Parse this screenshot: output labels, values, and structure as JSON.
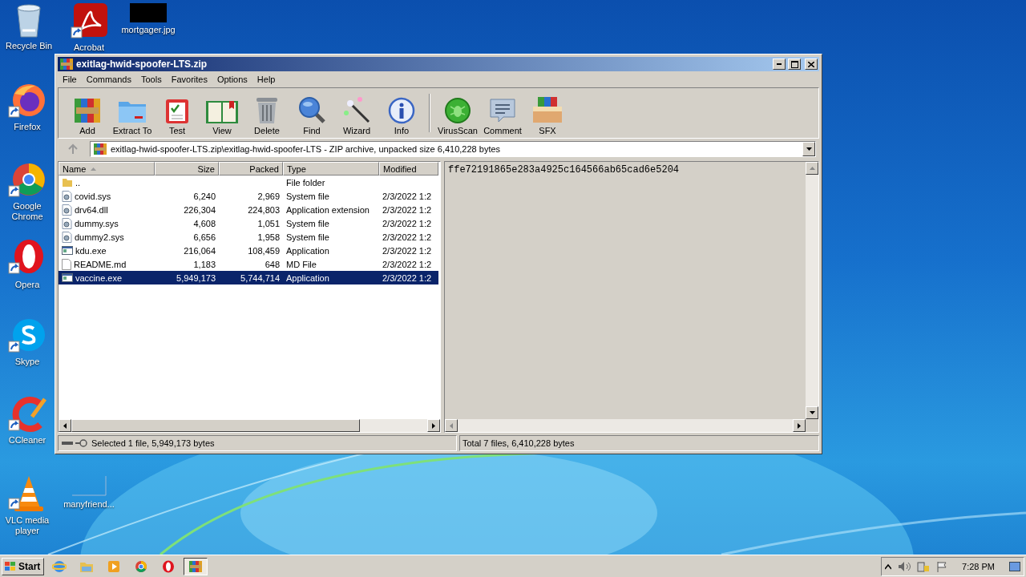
{
  "desktop": {
    "icons": [
      {
        "label": "Recycle Bin",
        "kind": "recycle"
      },
      {
        "label": "Acrobat",
        "kind": "pdf"
      },
      {
        "label": "mortgager.jpg",
        "kind": "blackimage"
      },
      {
        "label": "Firefox",
        "kind": "firefox"
      },
      {
        "label": "Google Chrome",
        "kind": "chrome"
      },
      {
        "label": "Opera",
        "kind": "opera"
      },
      {
        "label": "Skype",
        "kind": "skype"
      },
      {
        "label": "CCleaner",
        "kind": "ccleaner"
      },
      {
        "label": "VLC media player",
        "kind": "vlc"
      },
      {
        "label": "manyfriend...",
        "kind": "blankimage"
      }
    ]
  },
  "window": {
    "title": "exitlag-hwid-spoofer-LTS.zip",
    "menu": [
      "File",
      "Commands",
      "Tools",
      "Favorites",
      "Options",
      "Help"
    ],
    "toolbar": [
      {
        "label": "Add",
        "kind": "add"
      },
      {
        "label": "Extract To",
        "kind": "extract"
      },
      {
        "label": "Test",
        "kind": "test"
      },
      {
        "label": "View",
        "kind": "view"
      },
      {
        "label": "Delete",
        "kind": "delete"
      },
      {
        "label": "Find",
        "kind": "find"
      },
      {
        "label": "Wizard",
        "kind": "wizard"
      },
      {
        "label": "Info",
        "kind": "info"
      },
      {
        "label": "VirusScan",
        "kind": "virusscan"
      },
      {
        "label": "Comment",
        "kind": "comment"
      },
      {
        "label": "SFX",
        "kind": "sfx"
      }
    ],
    "address": {
      "path": "exitlag-hwid-spoofer-LTS.zip\\exitlag-hwid-spoofer-LTS - ZIP archive, unpacked size 6,410,228 bytes"
    },
    "file_list": {
      "columns": [
        {
          "label": "Name",
          "sorted": true
        },
        {
          "label": "Size",
          "sorted": false
        },
        {
          "label": "Packed",
          "sorted": false
        },
        {
          "label": "Type",
          "sorted": false
        },
        {
          "label": "Modified",
          "sorted": false
        }
      ],
      "rows": [
        {
          "name": "..",
          "size": "",
          "packed": "",
          "type": "File folder",
          "modified": "",
          "kind": "folder",
          "selected": false
        },
        {
          "name": "covid.sys",
          "size": "6,240",
          "packed": "2,969",
          "type": "System file",
          "modified": "2/3/2022 1:2",
          "kind": "system",
          "selected": false
        },
        {
          "name": "drv64.dll",
          "size": "226,304",
          "packed": "224,803",
          "type": "Application extension",
          "modified": "2/3/2022 1:2",
          "kind": "system",
          "selected": false
        },
        {
          "name": "dummy.sys",
          "size": "4,608",
          "packed": "1,051",
          "type": "System file",
          "modified": "2/3/2022 1:2",
          "kind": "system",
          "selected": false
        },
        {
          "name": "dummy2.sys",
          "size": "6,656",
          "packed": "1,958",
          "type": "System file",
          "modified": "2/3/2022 1:2",
          "kind": "system",
          "selected": false
        },
        {
          "name": "kdu.exe",
          "size": "216,064",
          "packed": "108,459",
          "type": "Application",
          "modified": "2/3/2022 1:2",
          "kind": "app",
          "selected": false
        },
        {
          "name": "README.md",
          "size": "1,183",
          "packed": "648",
          "type": "MD File",
          "modified": "2/3/2022 1:2",
          "kind": "file",
          "selected": false
        },
        {
          "name": "vaccine.exe",
          "size": "5,949,173",
          "packed": "5,744,714",
          "type": "Application",
          "modified": "2/3/2022 1:2",
          "kind": "app",
          "selected": true
        }
      ]
    },
    "preview": {
      "text": "ffe72191865e283a4925c164566ab65cad6e5204"
    },
    "status_bar": {
      "left": "Selected 1 file, 5,949,173 bytes",
      "right": "Total 7 files, 6,410,228 bytes"
    }
  },
  "taskbar": {
    "start": "Start",
    "items": [
      {
        "kind": "ie",
        "selected": false
      },
      {
        "kind": "explorer",
        "selected": false
      },
      {
        "kind": "media",
        "selected": false
      },
      {
        "kind": "chrome",
        "selected": false
      },
      {
        "kind": "opera",
        "selected": false
      },
      {
        "kind": "winrar",
        "selected": true
      }
    ],
    "time": "7:28 PM"
  }
}
